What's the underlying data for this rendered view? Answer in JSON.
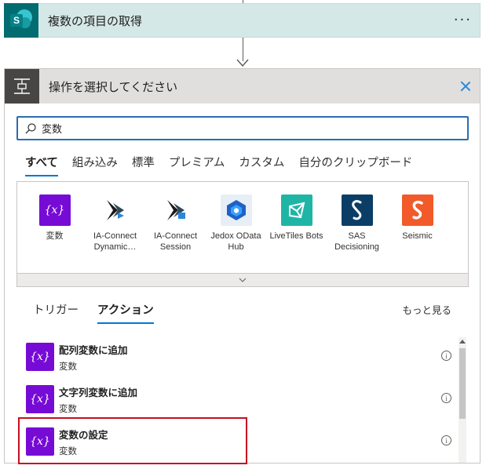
{
  "step1": {
    "title": "複数の項目の取得",
    "more_label": "···"
  },
  "step2": {
    "title": "操作を選択してください",
    "search": {
      "value": "変数"
    },
    "category_tabs": [
      {
        "label": "すべて",
        "active": true
      },
      {
        "label": "組み込み",
        "active": false
      },
      {
        "label": "標準",
        "active": false
      },
      {
        "label": "プレミアム",
        "active": false
      },
      {
        "label": "カスタム",
        "active": false
      },
      {
        "label": "自分のクリップボード",
        "active": false
      }
    ],
    "connectors": [
      {
        "label": "変数",
        "icon": "variable-icon",
        "color": "#770bd6"
      },
      {
        "label": "IA-Connect Dynamic…",
        "icon": "ia-connect-dynamics-icon",
        "color": "#ffffff"
      },
      {
        "label": "IA-Connect Session",
        "icon": "ia-connect-session-icon",
        "color": "#ffffff"
      },
      {
        "label": "Jedox OData Hub",
        "icon": "jedox-icon",
        "color": "#e8eef6"
      },
      {
        "label": "LiveTiles Bots",
        "icon": "livetiles-icon",
        "color": "#1fb5a6"
      },
      {
        "label": "SAS Decisioning",
        "icon": "sas-icon",
        "color": "#0b3e66"
      },
      {
        "label": "Seismic",
        "icon": "seismic-icon",
        "color": "#f25a29"
      }
    ],
    "sub_tabs": [
      {
        "label": "トリガー",
        "active": false
      },
      {
        "label": "アクション",
        "active": true
      }
    ],
    "see_more": "もっと見る",
    "actions": [
      {
        "title": "配列変数に追加",
        "subtitle": "変数",
        "highlighted": false
      },
      {
        "title": "文字列変数に追加",
        "subtitle": "変数",
        "highlighted": false
      },
      {
        "title": "変数の設定",
        "subtitle": "変数",
        "highlighted": true
      }
    ],
    "action_icon_label": "{x}"
  }
}
